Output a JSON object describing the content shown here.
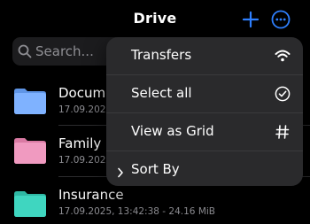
{
  "header": {
    "title": "Drive",
    "add_icon": "plus-icon",
    "more_icon": "ellipsis-circle-icon",
    "accent_color": "#2f80ff"
  },
  "search": {
    "placeholder": "Search...",
    "icon": "search-icon"
  },
  "files": [
    {
      "name": "Documents",
      "meta": "17.09.2025",
      "folder_color": "#7fb2ff"
    },
    {
      "name": "Family",
      "meta": "17.09.2025",
      "folder_color": "#f09ac0"
    },
    {
      "name": "Insurance",
      "meta": "17.09.2025, 13:42:38  -  24.16 MiB",
      "folder_color": "#3fd6c0"
    }
  ],
  "menu": {
    "items": [
      {
        "label": "Transfers",
        "icon": "wifi-icon"
      },
      {
        "label": "Select all",
        "icon": "checkmark-circle-icon"
      },
      {
        "label": "View as Grid",
        "icon": "grid-hash-icon"
      },
      {
        "label": "Sort By",
        "icon": "chevron-right-icon"
      }
    ]
  }
}
